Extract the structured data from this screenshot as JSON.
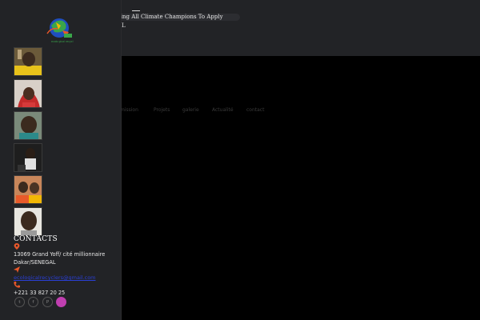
{
  "topbar": {
    "ticker": "ting All Climate Champions To Apply",
    "trail": "L"
  },
  "nav": {
    "items": [
      "mission",
      "Projets",
      "galerie",
      "Actualité",
      "contact"
    ]
  },
  "sidebar": {
    "contacts_title": "CONTACTS",
    "address_line1": "13069 Grand Yoff/ cité millionnaire",
    "address_line2": "Dakar/SENEGAL",
    "email": "ecologicalrecyclers@gmail.com",
    "phone": "+221 33 827 20 25",
    "social": [
      {
        "icon": "twitter-icon",
        "glyph": "t"
      },
      {
        "icon": "facebook-icon",
        "glyph": "f"
      },
      {
        "icon": "pinterest-icon",
        "glyph": "P"
      },
      {
        "icon": "dribbble-icon",
        "glyph": ""
      }
    ]
  },
  "colors": {
    "sidebar_bg": "#222326",
    "accent_orange": "#e8572a",
    "link_blue": "#2a3fd6",
    "social_active": "#c03fb0"
  }
}
